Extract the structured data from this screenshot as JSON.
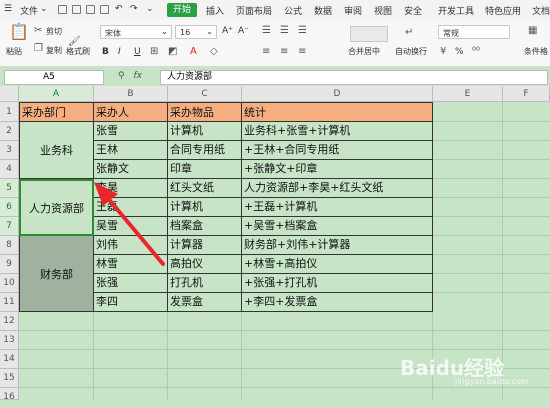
{
  "menu": {
    "file": "文件",
    "tabs": [
      "开始",
      "插入",
      "页面布局",
      "公式",
      "数据",
      "审阅",
      "视图",
      "安全",
      "开发工具",
      "特色应用",
      "文档助"
    ],
    "active_tab": "开始",
    "active_color": "#2aa147"
  },
  "ribbon": {
    "paste": "粘贴",
    "cut": "剪切",
    "copy": "复制",
    "format_painter": "格式刷",
    "font_name": "宋体",
    "font_size": "16",
    "bold": "B",
    "italic": "I",
    "underline": "U",
    "merge_center": "合并居中",
    "wrap_text": "自动换行",
    "number_format": "常规",
    "percent": "%",
    "cond_format": "条件格"
  },
  "formula_bar": {
    "name_box": "A5",
    "fx": "fx",
    "content": "人力资源部"
  },
  "columns": [
    "A",
    "B",
    "C",
    "D",
    "E",
    "F"
  ],
  "rows": [
    "1",
    "2",
    "3",
    "4",
    "5",
    "6",
    "7",
    "8",
    "9",
    "10",
    "11",
    "12",
    "13",
    "14",
    "15",
    "16"
  ],
  "table": {
    "headers": [
      "采办部门",
      "采办人",
      "采办物品",
      "统计"
    ],
    "header_color": "#f5ae80",
    "departments": [
      "业务科",
      "人力资源部",
      "财务部"
    ],
    "people": [
      "张雪",
      "王林",
      "张静文",
      "李昊",
      "王磊",
      "吴雪",
      "刘伟",
      "林雪",
      "张强",
      "李四"
    ],
    "items": [
      "计算机",
      "合同专用纸",
      "印章",
      "红头文纸",
      "计算机",
      "档案盒",
      "计算器",
      "高拍仪",
      "打孔机",
      "发票盒"
    ],
    "stats": [
      "业务科+张雪+计算机",
      "+王林+合同专用纸",
      "+张静文+印章",
      "人力资源部+李昊+红头文纸",
      "+王磊+计算机",
      "+吴雪+档案盒",
      "财务部+刘伟+计算器",
      "+林雪+高拍仪",
      "+张强+打孔机",
      "+李四+发票盒"
    ]
  },
  "watermark": {
    "brand": "Baidu经验",
    "sub": "jingyan.baidu.com"
  },
  "annotation": {
    "arrow_color": "#e8262b"
  }
}
